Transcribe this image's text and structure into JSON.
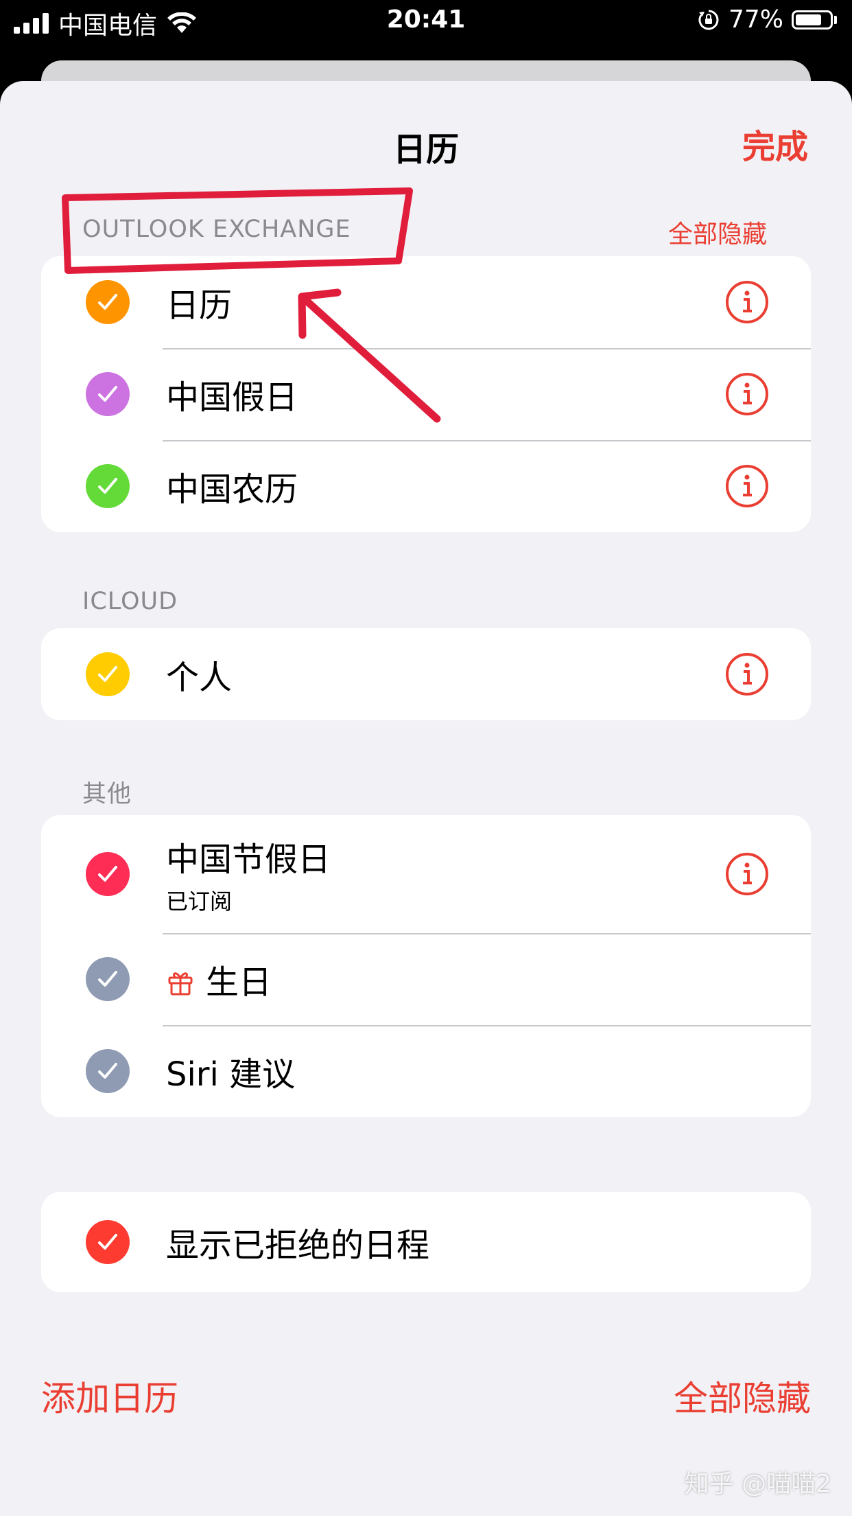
{
  "status_bar": {
    "carrier": "中国电信",
    "time": "20:41",
    "battery": "77%",
    "battery_level": 0.77
  },
  "sheet": {
    "title": "日历",
    "done_label": "完成"
  },
  "sections": {
    "outlook": {
      "header": "OUTLOOK EXCHANGE",
      "action": "全部隐藏",
      "items": [
        {
          "label": "日历",
          "color": "#fe9500"
        },
        {
          "label": "中国假日",
          "color": "#cc73e1"
        },
        {
          "label": "中国农历",
          "color": "#63da38"
        }
      ]
    },
    "icloud": {
      "header": "ICLOUD",
      "items": [
        {
          "label": "个人",
          "color": "#fecc00"
        }
      ]
    },
    "other": {
      "header": "其他",
      "items": [
        {
          "label": "中国节假日",
          "sublabel": "已订阅",
          "color": "#fe2d55"
        },
        {
          "label": "生日",
          "color": "#8e9bb3",
          "icon": "gift-icon"
        },
        {
          "label": "Siri 建议",
          "color": "#8e9bb3"
        }
      ]
    },
    "declined": {
      "items": [
        {
          "label": "显示已拒绝的日程",
          "color": "#fe3b30"
        }
      ]
    }
  },
  "bottom_bar": {
    "add_calendar": "添加日历",
    "hide_all": "全部隐藏"
  },
  "watermark": "知乎 @喵喵2",
  "colors": {
    "accent": "#ea3e32",
    "annotation": "#e01e3c"
  }
}
